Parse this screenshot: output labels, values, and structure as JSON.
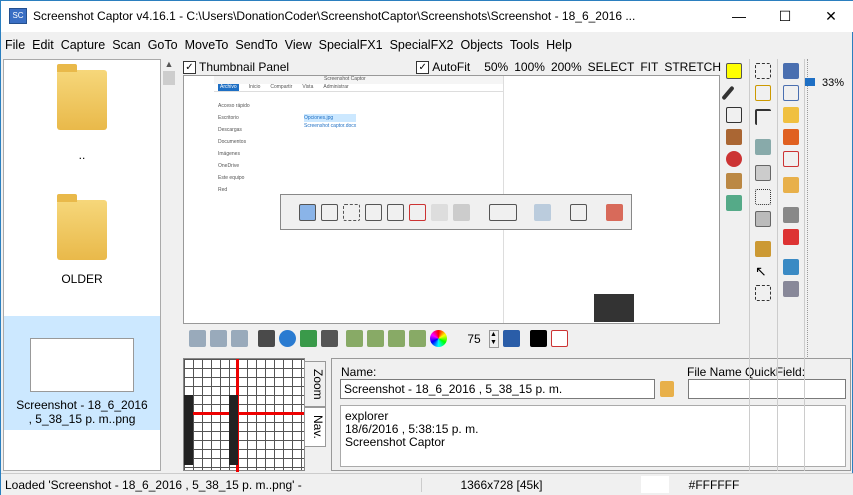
{
  "window": {
    "title": "Screenshot Captor v4.16.1 - C:\\Users\\DonationCoder\\ScreenshotCaptor\\Screenshots\\Screenshot - 18_6_2016 ...",
    "icon_label": "SC",
    "minimize": "—",
    "maximize": "☐",
    "close": "✕"
  },
  "menu": [
    "File",
    "Edit",
    "Capture",
    "Scan",
    "GoTo",
    "MoveTo",
    "SendTo",
    "View",
    "SpecialFX1",
    "SpecialFX2",
    "Objects",
    "Tools",
    "Help"
  ],
  "thumbnails": [
    {
      "label": ".."
    },
    {
      "label": "OLDER"
    },
    {
      "label": "Screenshot - 18_6_2016 , 5_38_15 p. m..png"
    }
  ],
  "viewbar": {
    "thumbnail_panel": "Thumbnail Panel",
    "autofit": "AutoFit",
    "zoom_options": [
      "50%",
      "100%",
      "200%",
      "SELECT",
      "FIT",
      "STRETCH"
    ]
  },
  "toolbar": {
    "zoom_value": "75"
  },
  "preview": {
    "explorer_title": "Screenshot Captor",
    "ribbon_tabs": [
      "Archivo",
      "Inicio",
      "Compartir",
      "Vista",
      "Administrar"
    ],
    "files": [
      "Opciones.jpg",
      "Screenshot captor.docx"
    ],
    "tree": [
      "Acceso rápido",
      "Escritorio",
      "Descargas",
      "Documentos",
      "Imágenes",
      "OneDrive",
      "Este equipo",
      "Red"
    ]
  },
  "tabs": {
    "zoom": "Zoom",
    "nav": "Nav."
  },
  "info": {
    "name_label": "Name:",
    "name_value": "Screenshot - 18_6_2016 , 5_38_15 p. m.",
    "quickfield_label": "File Name QuickField:",
    "quickfield_value": "",
    "notes": [
      "explorer",
      "18/6/2016 , 5:38:15 p. m.",
      "Screenshot Captor"
    ]
  },
  "right": {
    "zoom_percent": "33%"
  },
  "status": {
    "message": "Loaded 'Screenshot - 18_6_2016 , 5_38_15 p. m..png'  -",
    "dimensions": "1366x728  [45k]",
    "color": "#FFFFFF"
  }
}
